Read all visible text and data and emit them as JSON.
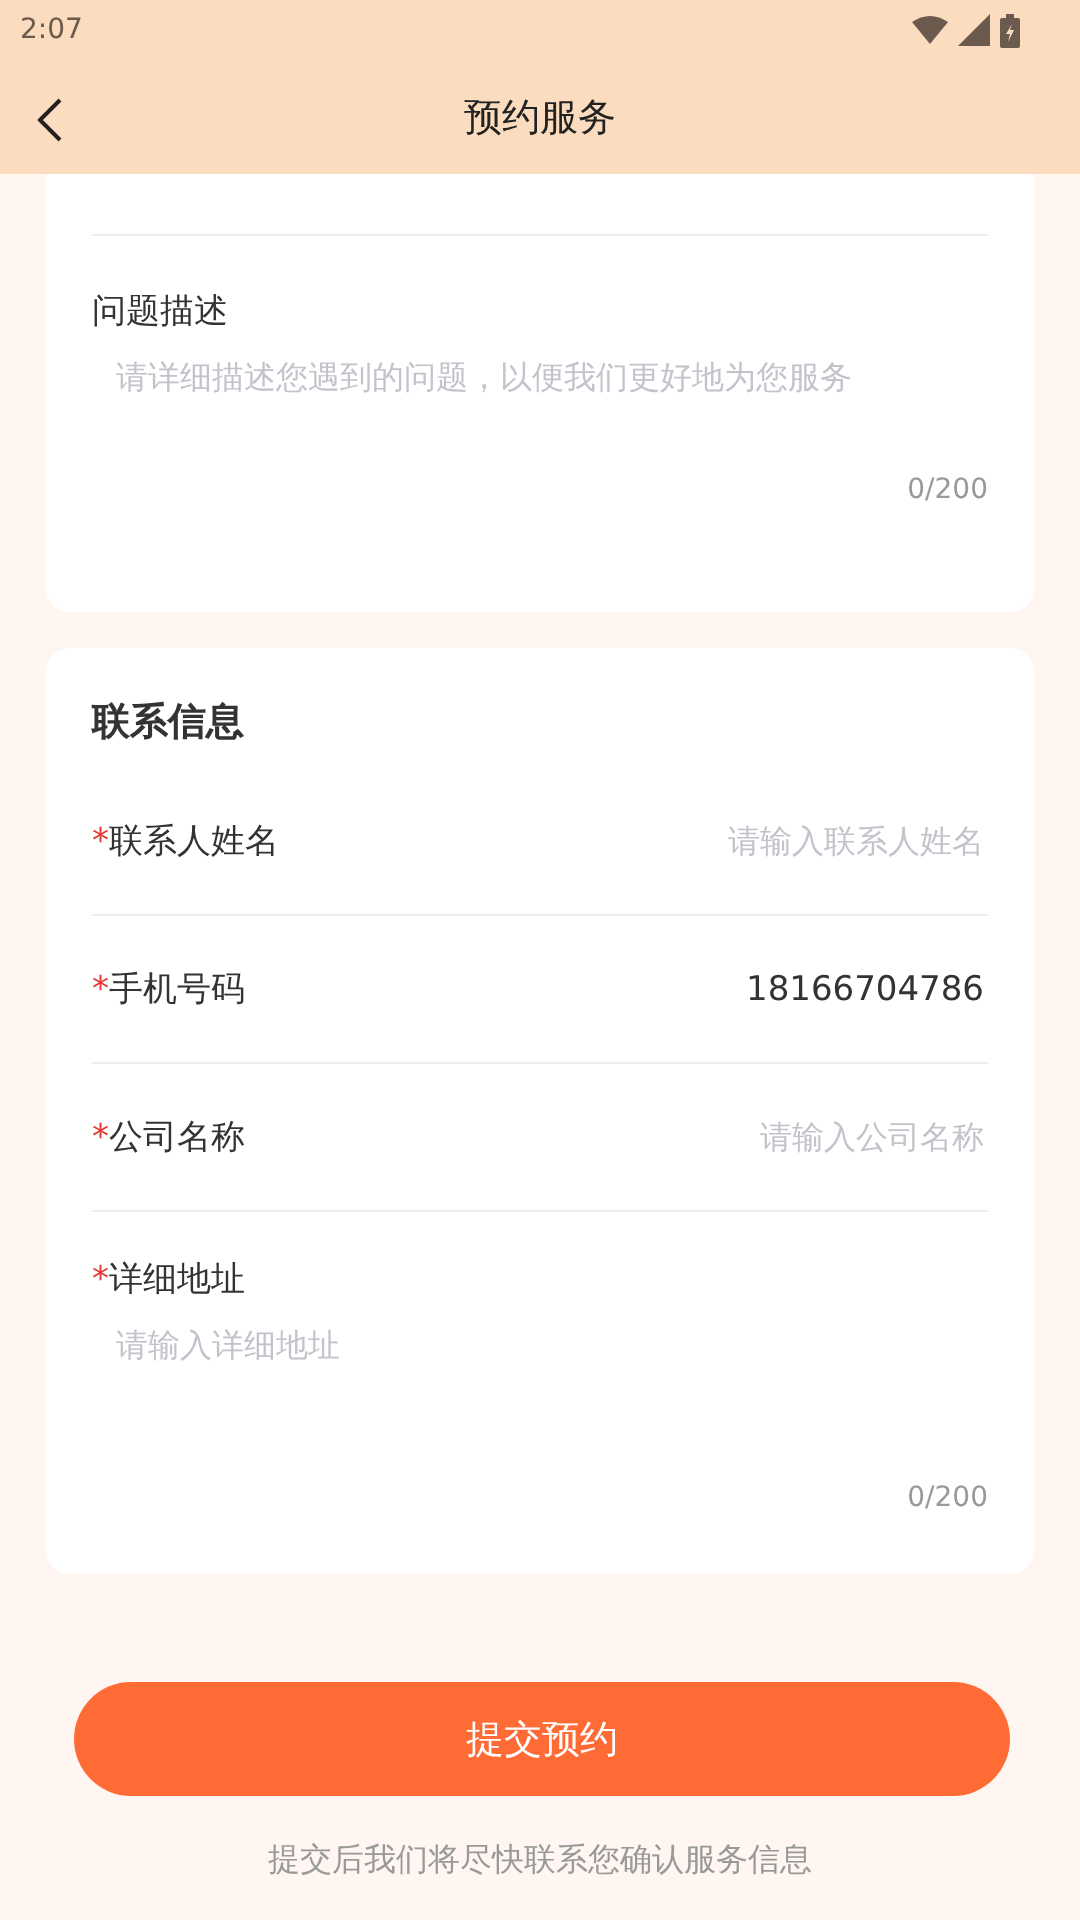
{
  "status_bar": {
    "time": "2:07"
  },
  "header": {
    "title": "预约服务"
  },
  "description": {
    "label": "问题描述",
    "placeholder": "请详细描述您遇到的问题，以便我们更好地为您服务",
    "counter": "0/200"
  },
  "contact": {
    "title": "联系信息",
    "required_mark": "*",
    "fields": [
      {
        "kind": "inline",
        "required": true,
        "label": "联系人姓名",
        "placeholder": "请输入联系人姓名"
      },
      {
        "kind": "inline",
        "required": true,
        "label": "手机号码",
        "value": "18166704786"
      },
      {
        "kind": "inline",
        "required": true,
        "label": "公司名称",
        "placeholder": "请输入公司名称"
      },
      {
        "kind": "textarea",
        "required": true,
        "label": "详细地址",
        "placeholder": "请输入详细地址",
        "counter": "0/200"
      }
    ]
  },
  "submit": {
    "label": "提交预约"
  },
  "footer_note": "提交后我们将尽快联系您确认服务信息"
}
